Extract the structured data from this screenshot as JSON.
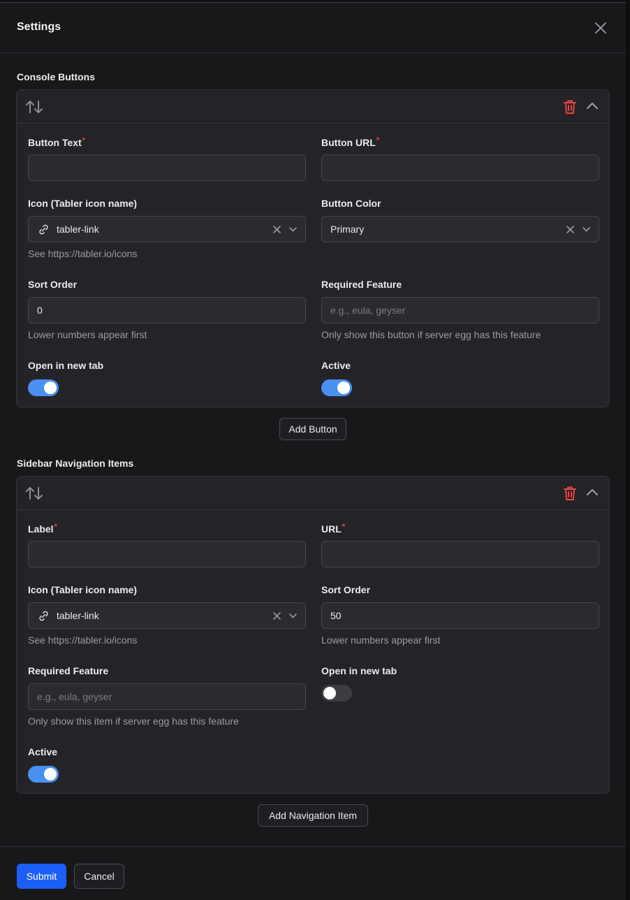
{
  "dialog": {
    "title": "Settings"
  },
  "console_buttons": {
    "section_label": "Console Buttons",
    "item": {
      "button_text": {
        "label": "Button Text",
        "required": "*",
        "value": ""
      },
      "button_url": {
        "label": "Button URL",
        "required": "*",
        "value": ""
      },
      "icon": {
        "label": "Icon (Tabler icon name)",
        "value": "tabler-link",
        "hint": "See https://tabler.io/icons"
      },
      "button_color": {
        "label": "Button Color",
        "value": "Primary"
      },
      "sort_order": {
        "label": "Sort Order",
        "value": "0",
        "hint": "Lower numbers appear first"
      },
      "required_feature": {
        "label": "Required Feature",
        "placeholder": "e.g., eula, geyser",
        "value": "",
        "hint": "Only show this button if server egg has this feature"
      },
      "open_new_tab": {
        "label": "Open in new tab",
        "on": true
      },
      "active": {
        "label": "Active",
        "on": true
      }
    },
    "add_label": "Add Button"
  },
  "sidebar_nav": {
    "section_label": "Sidebar Navigation Items",
    "item": {
      "label_field": {
        "label": "Label",
        "required": "*",
        "value": ""
      },
      "url": {
        "label": "URL",
        "required": "*",
        "value": ""
      },
      "icon": {
        "label": "Icon (Tabler icon name)",
        "value": "tabler-link",
        "hint": "See https://tabler.io/icons"
      },
      "sort_order": {
        "label": "Sort Order",
        "value": "50",
        "hint": "Lower numbers appear first"
      },
      "required_feature": {
        "label": "Required Feature",
        "placeholder": "e.g., eula, geyser",
        "value": "",
        "hint": "Only show this item if server egg has this feature"
      },
      "open_new_tab": {
        "label": "Open in new tab",
        "on": false
      },
      "active": {
        "label": "Active",
        "on": true
      }
    },
    "add_label": "Add Navigation Item"
  },
  "footer": {
    "submit_label": "Submit",
    "cancel_label": "Cancel"
  },
  "colors": {
    "accent": "#4a90f0",
    "primary_button": "#1b5ff5",
    "danger": "#ef4444",
    "background": "#18181b",
    "card": "#242428"
  },
  "icons": [
    "close-icon",
    "sort-arrows-icon",
    "trash-icon",
    "chevron-up-icon",
    "link-icon",
    "clear-x-icon",
    "chevron-down-icon"
  ]
}
